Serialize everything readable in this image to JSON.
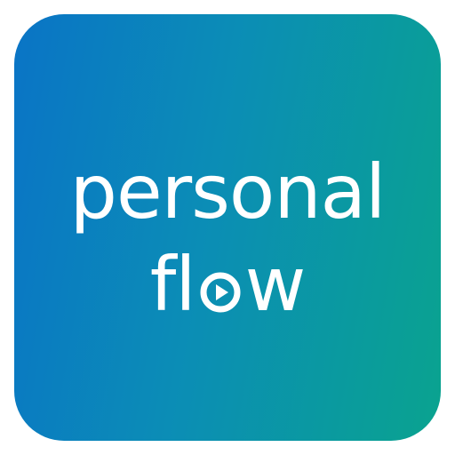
{
  "logo": {
    "line1": "personal",
    "line2_prefix": "fl",
    "line2_o": "o",
    "line2_suffix": "w",
    "icon": "play-icon"
  },
  "colors": {
    "gradient_start": "#0a74c6",
    "gradient_mid": "#0b8db6",
    "gradient_end": "#0aa38f",
    "text": "#ffffff"
  }
}
